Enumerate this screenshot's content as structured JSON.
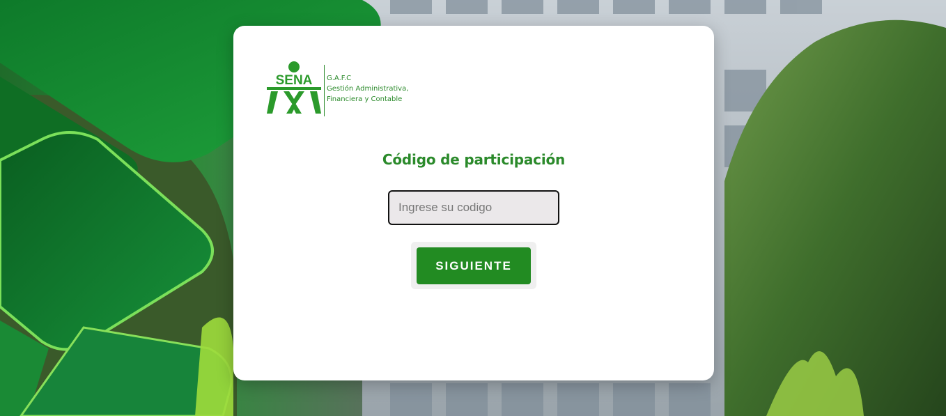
{
  "background": {
    "description": "green geometric shapes left, building and trees right"
  },
  "logo": {
    "brand": "SENA",
    "line1": "G.A.F.C",
    "line2": "Gestión Administrativa,",
    "line3": "Financiera y Contable"
  },
  "form": {
    "title": "Código de participación",
    "code_placeholder": "Ingrese su codigo",
    "code_value": "",
    "submit_label": "SIGUIENTE"
  },
  "colors": {
    "brand_green": "#228b22",
    "text_green": "#2b8a2b",
    "input_bg": "#ebe8ea"
  }
}
